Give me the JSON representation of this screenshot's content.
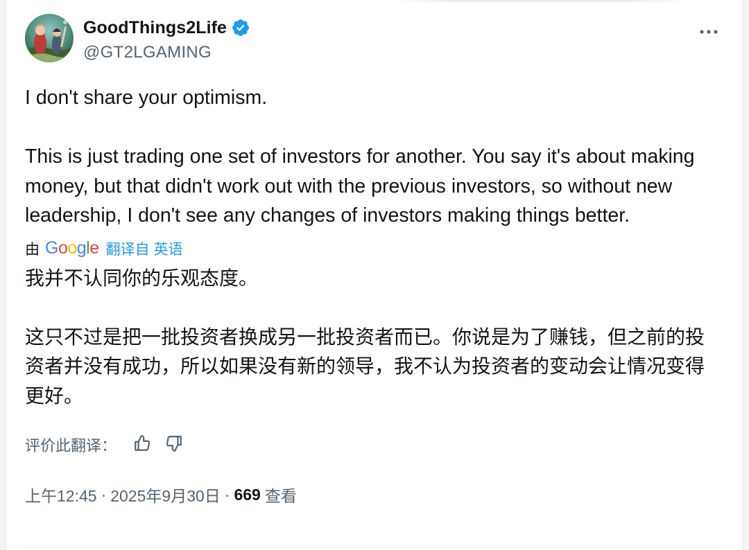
{
  "author": {
    "display_name": "GoodThings2Life",
    "handle": "@GT2LGAMING",
    "verified": true
  },
  "more_icon": "more-horizontal-icon",
  "tweet_text": "I don't share your optimism.\n\nThis is just trading one set of investors for another. You say it's about making money, but that didn't work out with the previous investors, so without new leadership, I don't see any changes of investors making things better.",
  "translation": {
    "by_label": "由",
    "provider": "Google",
    "source_label": "翻译自 英语",
    "text": "我并不认同你的乐观态度。\n\n这只不过是把一批投资者换成另一批投资者而已。你说是为了赚钱，但之前的投资者并没有成功，所以如果没有新的领导，我不认为投资者的变动会让情况变得更好。",
    "rate_label": "评价此翻译：",
    "thumbs_up_icon": "thumbs-up-icon",
    "thumbs_down_icon": "thumbs-down-icon"
  },
  "meta": {
    "time": "上午12:45",
    "date": "2025年9月30日",
    "separator": "·",
    "views_count": "669",
    "views_label": "查看"
  },
  "colors": {
    "text_primary": "#0f1419",
    "text_secondary": "#536471",
    "link_blue": "#1d9bf0",
    "verified_blue": "#1d9bf0"
  }
}
